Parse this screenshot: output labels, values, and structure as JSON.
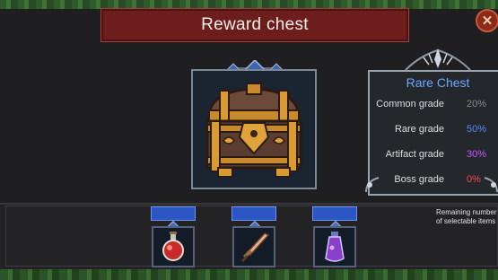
{
  "header": {
    "title": "Reward chest",
    "close_icon": "close-x-icon"
  },
  "chest": {
    "icon": "treasure-chest-icon"
  },
  "info": {
    "title": "Rare Chest",
    "rows": [
      {
        "label": "Common grade",
        "value": "20%",
        "color": "#8a8a8a"
      },
      {
        "label": "Rare grade",
        "value": "50%",
        "color": "#4f8dff"
      },
      {
        "label": "Artifact grade",
        "value": "30%",
        "color": "#c35bff"
      },
      {
        "label": "Boss grade",
        "value": "0%",
        "color": "#ff4a4a"
      }
    ]
  },
  "selection": {
    "remaining_line1": "Remaining number",
    "remaining_line2": "of selectable items",
    "items": [
      {
        "icon": "red-potion-icon"
      },
      {
        "icon": "sword-icon"
      },
      {
        "icon": "purple-potion-icon"
      }
    ]
  }
}
